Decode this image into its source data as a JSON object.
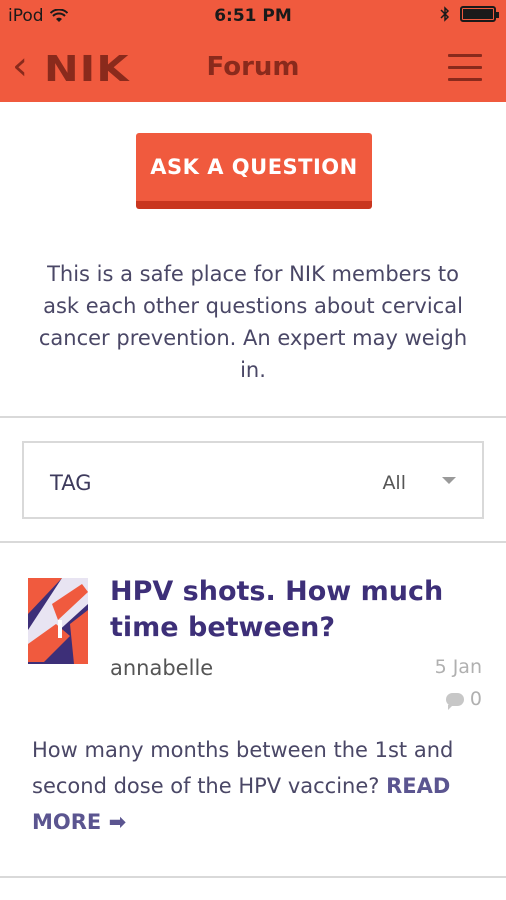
{
  "status_bar": {
    "carrier": "iPod",
    "time": "6:51 PM"
  },
  "nav": {
    "logo": "NIK",
    "title": "Forum"
  },
  "ask_button": {
    "label": "ASK A QUESTION"
  },
  "intro": "This is a safe place for NIK members to ask each other questions about cervical cancer prevention. An expert may weigh in.",
  "filter": {
    "label": "TAG",
    "value": "All"
  },
  "posts": [
    {
      "title": "HPV shots. How much time between?",
      "author": "annabelle",
      "date": "5 Jan",
      "comments": "0",
      "body": "How many months between the 1st and second dose of the HPV vaccine?",
      "read_more": "READ MORE ➡"
    }
  ],
  "colors": {
    "brand": "#f05a3e",
    "brand_dark": "#8a2a1c",
    "title": "#3d2f78"
  }
}
